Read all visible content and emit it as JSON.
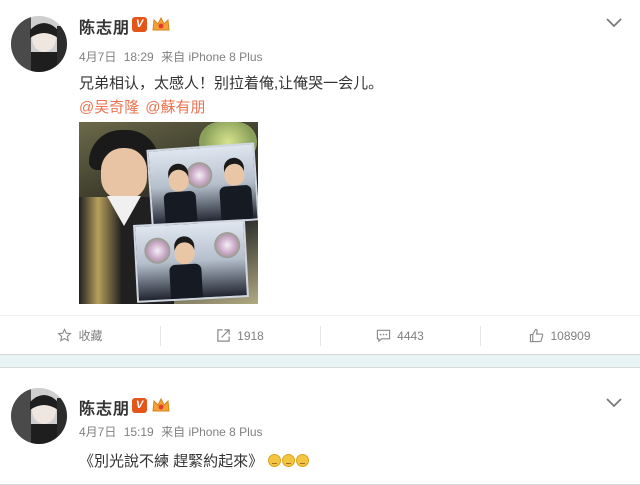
{
  "posts": [
    {
      "username": "陈志朋",
      "verified_badge": "V",
      "crown_icon": "crown-icon",
      "date": "4月7日",
      "time": "18:29",
      "source_prefix": "来自",
      "source": "iPhone 8 Plus",
      "text": "兄弟相认，太感人！别拉着俺,让俺哭一会儿。",
      "mentions": [
        "@吴奇隆",
        "@蘇有朋"
      ],
      "actions": [
        {
          "icon": "star-icon",
          "label": "收藏"
        },
        {
          "icon": "share-icon",
          "label": "1918"
        },
        {
          "icon": "comment-icon",
          "label": "4443"
        },
        {
          "icon": "thumbs-up-icon",
          "label": "108909"
        }
      ]
    },
    {
      "username": "陈志朋",
      "verified_badge": "V",
      "crown_icon": "crown-icon",
      "date": "4月7日",
      "time": "15:19",
      "source_prefix": "来自",
      "source": "iPhone 8 Plus",
      "text": "《別光說不練 趕緊約起來》",
      "emoji_count": 3
    }
  ],
  "colors": {
    "badge": "#e45519",
    "mention": "#eb7350",
    "background": "#e8f3f6"
  }
}
